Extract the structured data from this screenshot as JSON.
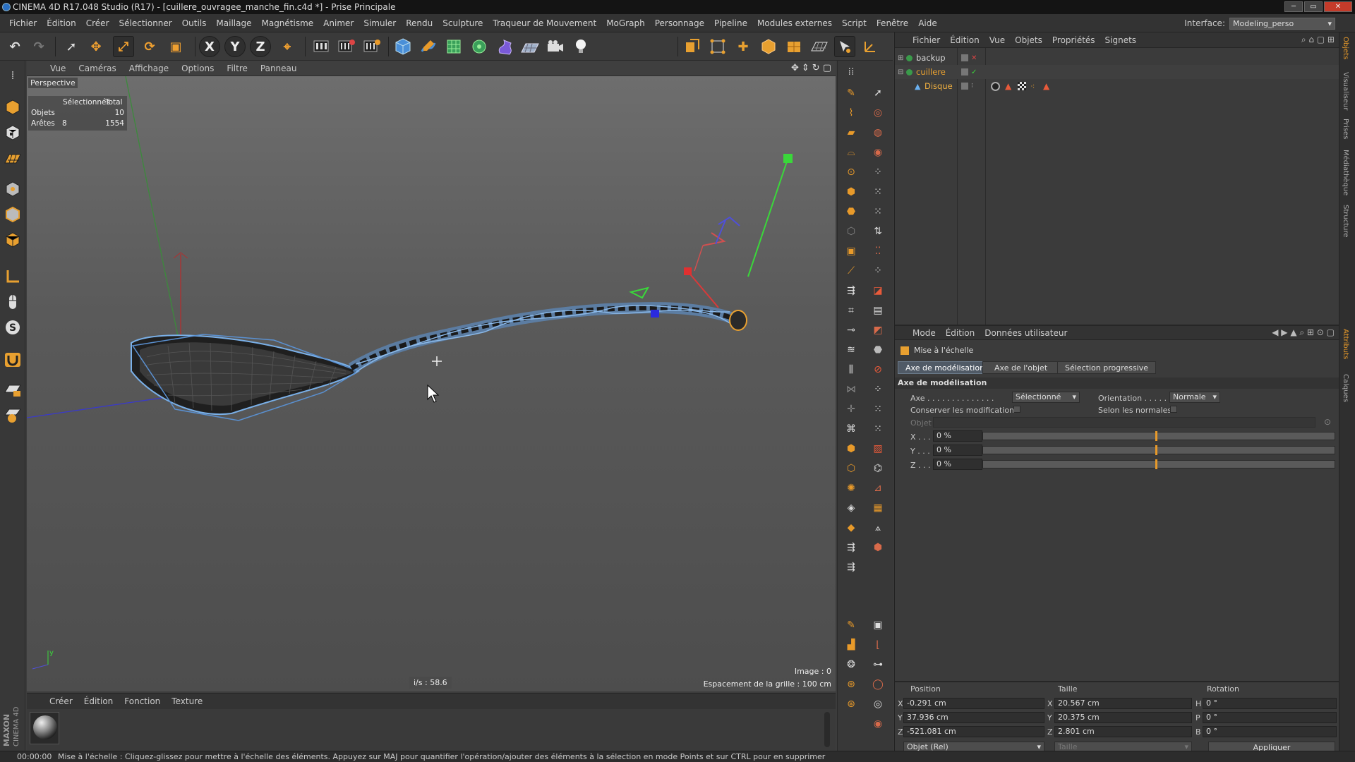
{
  "window": {
    "title": "CINEMA 4D R17.048 Studio (R17) - [cuillere_ouvragee_manche_fin.c4d *] - Prise Principale",
    "controls": [
      "─",
      "▭",
      "✕"
    ]
  },
  "menu": [
    "Fichier",
    "Édition",
    "Créer",
    "Sélectionner",
    "Outils",
    "Maillage",
    "Magnétisme",
    "Animer",
    "Simuler",
    "Rendu",
    "Sculpture",
    "Traqueur de Mouvement",
    "MoGraph",
    "Personnage",
    "Pipeline",
    "Modules externes",
    "Script",
    "Fenêtre",
    "Aide"
  ],
  "interface": {
    "label": "Interface:",
    "value": "Modeling_perso"
  },
  "toolbar": {
    "undo": "↶",
    "redo": "↷",
    "select": "➚",
    "move": "✥",
    "scale": "⤢",
    "rotate": "⟳",
    "last": "▣",
    "axis_x": "X",
    "axis_y": "Y",
    "axis_z": "Z",
    "coord": "⌖"
  },
  "viewport": {
    "menu": [
      "Vue",
      "Caméras",
      "Affichage",
      "Options",
      "Filtre",
      "Panneau"
    ],
    "nav_icons": [
      "✥",
      "⇕",
      "↻",
      "▢"
    ],
    "camera": "Perspective",
    "stats": {
      "header": [
        "Sélectionnés",
        "Total"
      ],
      "rows": [
        {
          "label": "Objets",
          "selected": "",
          "total": "10"
        },
        {
          "label": "Arêtes",
          "selected": "8",
          "total": "1554"
        }
      ]
    },
    "fps": "i/s : 58.6",
    "frame": "Image : 0",
    "grid": "Espacement de la grille : 100 cm",
    "axis_y": "y"
  },
  "objects": {
    "menu": [
      "Fichier",
      "Édition",
      "Vue",
      "Objets",
      "Propriétés",
      "Signets"
    ],
    "items": [
      {
        "name": "backup",
        "color": "#d8d8d8"
      },
      {
        "name": "cuillere",
        "color": "#e8a030"
      },
      {
        "name": "Disque",
        "color": "#f0b040"
      }
    ]
  },
  "attributes": {
    "menu": [
      "Mode",
      "Édition",
      "Données utilisateur"
    ],
    "tool": "Mise à l'échelle",
    "tabs": [
      "Axe de modélisation",
      "Axe de l'objet",
      "Sélection progressive"
    ],
    "section": "Axe de modélisation",
    "axe_label": "Axe . . . . . . . . . . . . . .",
    "axe_value": "Sélectionné",
    "orientation_label": "Orientation . . . . .",
    "orientation_value": "Normale",
    "conserver": "Conserver les modifications",
    "normales": "Selon les normales",
    "objet": "Objet",
    "x_label": "X . . . .",
    "x_value": "0 %",
    "y_label": "Y . . . .",
    "y_value": "0 %",
    "z_label": "Z . . . .",
    "z_value": "0 %",
    "slider_pct": 0.49
  },
  "coords": {
    "headers": [
      "Position",
      "Taille",
      "Rotation"
    ],
    "pos": {
      "x": "-0.291 cm",
      "y": "37.936 cm",
      "z": "-521.081 cm"
    },
    "size": {
      "x": "20.567 cm",
      "y": "20.375 cm",
      "z": "2.801 cm"
    },
    "rot": {
      "h": "0 °",
      "p": "0 °",
      "b": "0 °"
    },
    "mode": "Objet (Rel)",
    "size_mode": "Taille",
    "apply": "Appliquer",
    "labels": {
      "x": "X",
      "y": "Y",
      "z": "Z",
      "h": "H",
      "p": "P",
      "b": "B"
    }
  },
  "materials": {
    "menu": [
      "Créer",
      "Édition",
      "Fonction",
      "Texture"
    ]
  },
  "status": {
    "time": "00:00:00",
    "message": "Mise à l'échelle : Cliquez-glissez pour mettre à l'échelle des éléments. Appuyez sur MAJ pour quantifier l'opération/ajouter des éléments à la sélection en mode Points et sur CTRL pour en supprimer"
  },
  "brand": {
    "line1": "MAXON",
    "line2": "CINEMA 4D"
  },
  "side_tabs": [
    "Objets",
    "Visualiseur",
    "Prises",
    "Médiathèque",
    "Structure",
    "Attributs",
    "Calques"
  ]
}
